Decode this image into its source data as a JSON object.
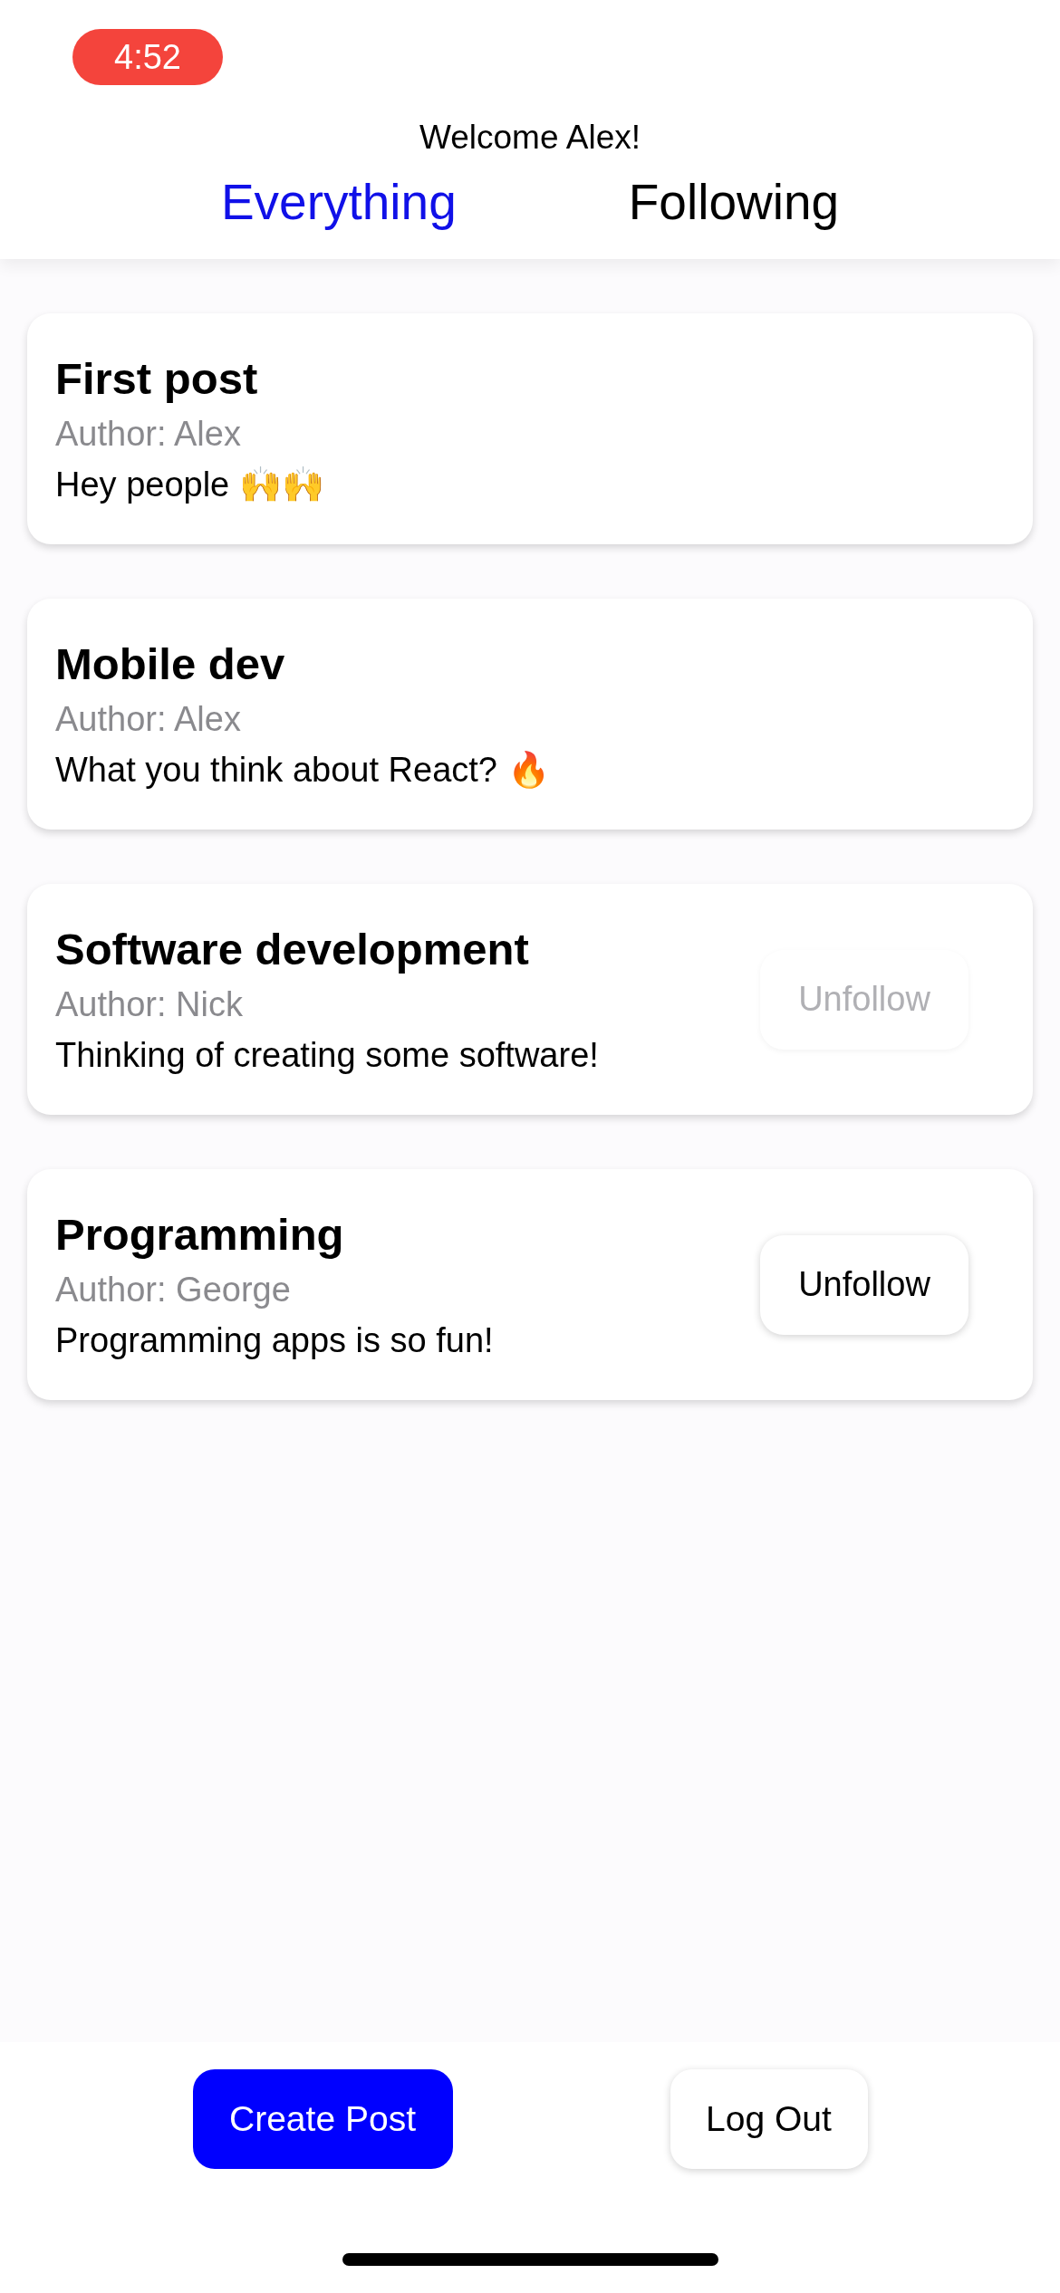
{
  "status_bar": {
    "time": "4:52"
  },
  "header": {
    "welcome": "Welcome Alex!"
  },
  "tabs": [
    {
      "label": "Everything",
      "selected": true
    },
    {
      "label": "Following",
      "selected": false
    }
  ],
  "posts": [
    {
      "title": "First post",
      "author": "Author: Alex",
      "body": "Hey people 🙌🙌"
    },
    {
      "title": "Mobile dev",
      "author": "Author: Alex",
      "body": "What you think about React? 🔥"
    },
    {
      "title": "Software development",
      "author": "Author: Nick",
      "body": "Thinking of creating some software!",
      "button": {
        "label": "Unfollow",
        "disabled": true
      }
    },
    {
      "title": "Programming",
      "author": "Author: George",
      "body": "Programming apps is so fun!",
      "button": {
        "label": "Unfollow",
        "disabled": false
      }
    }
  ],
  "footer": {
    "create_button": "Create Post",
    "logout_button": "Log Out"
  }
}
